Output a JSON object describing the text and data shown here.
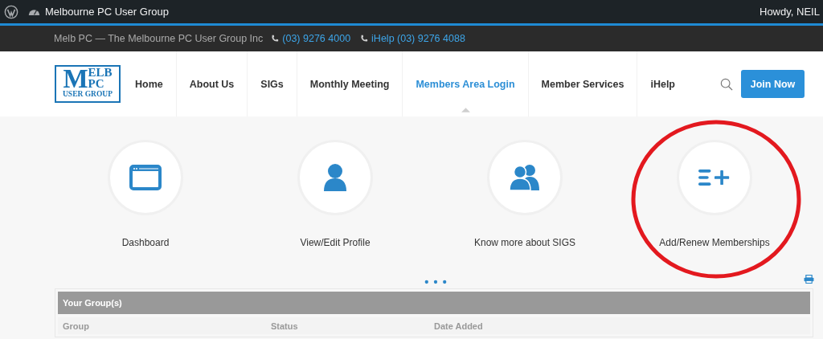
{
  "admin_bar": {
    "site_name": "Melbourne PC User Group",
    "greeting": "Howdy, NEIL"
  },
  "top_bar": {
    "org": "Melb PC — The Melbourne PC User Group Inc",
    "phones": [
      "(03) 9276 4000",
      "iHelp (03) 9276 4088"
    ]
  },
  "logo": {
    "big": "M",
    "top": "ELB",
    "middle": "PC",
    "bottom": "USER GROUP"
  },
  "nav": [
    {
      "label": "Home",
      "selected": false
    },
    {
      "label": "About Us",
      "selected": false
    },
    {
      "label": "SIGs",
      "selected": false
    },
    {
      "label": "Monthly Meeting",
      "selected": false
    },
    {
      "label": "Members Area Login",
      "selected": true
    },
    {
      "label": "Member Services",
      "selected": false
    },
    {
      "label": "iHelp",
      "selected": false
    }
  ],
  "join_button": "Join Now",
  "tiles": [
    {
      "kind": "window",
      "label": "Dashboard"
    },
    {
      "kind": "person",
      "label": "View/Edit Profile"
    },
    {
      "kind": "people",
      "label": "Know more about SIGS"
    },
    {
      "kind": "add-list",
      "label": "Add/Renew Memberships",
      "circled": true
    }
  ],
  "groups_panel": {
    "title": "Your Group(s)",
    "columns": [
      "Group",
      "Status",
      "Date Added"
    ]
  }
}
